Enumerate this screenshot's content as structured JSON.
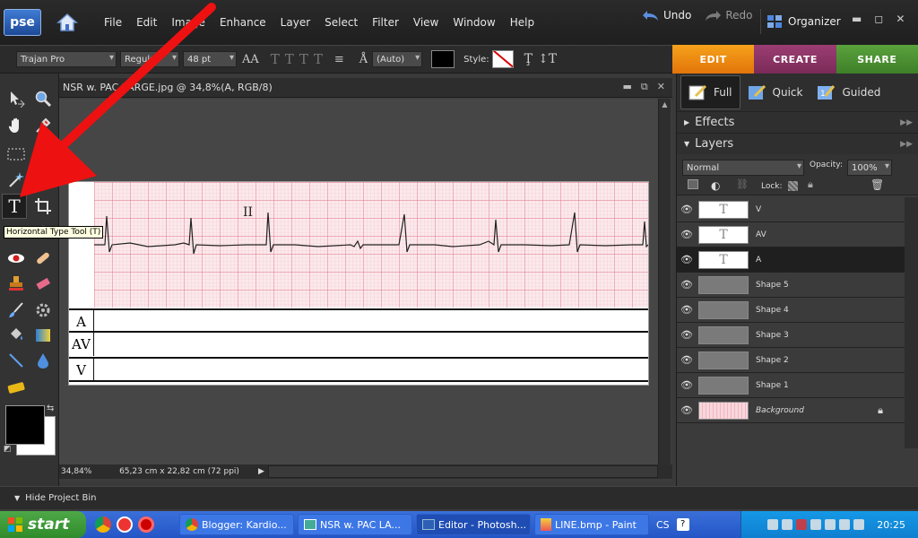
{
  "app": {
    "logo": "pse",
    "menus": [
      "File",
      "Edit",
      "Image",
      "Enhance",
      "Layer",
      "Select",
      "Filter",
      "View",
      "Window",
      "Help"
    ],
    "undo_label": "Undo",
    "redo_label": "Redo",
    "organizer_label": "Organizer"
  },
  "options": {
    "font_family": "Trajan Pro",
    "font_style": "Regular",
    "font_size": "48 pt",
    "leading": "(Auto)",
    "style_label": "Style:",
    "text_color": "#000000"
  },
  "mode_tabs": [
    "EDIT",
    "CREATE",
    "SHARE"
  ],
  "tooltip": "Horizontal Type Tool (T)",
  "document": {
    "title": "NSR w. PAC LARGE.jpg @ 34,8%(A, RGB/8)",
    "zoom": "34,84%",
    "dimensions": "65,23 cm x 22,82 cm (72 ppi)",
    "ecg_lead_label": "II",
    "rows": [
      "A",
      "AV",
      "V"
    ]
  },
  "view_tabs": [
    "Full",
    "Quick",
    "Guided"
  ],
  "panels": {
    "effects": "Effects",
    "layers": "Layers",
    "blend_mode": "Normal",
    "opacity_label": "Opacity:",
    "opacity_value": "100%",
    "lock_label": "Lock:"
  },
  "layers": [
    {
      "name": "V",
      "kind": "text",
      "selected": false
    },
    {
      "name": "AV",
      "kind": "text",
      "selected": false
    },
    {
      "name": "A",
      "kind": "text",
      "selected": true
    },
    {
      "name": "Shape 5",
      "kind": "shape",
      "selected": false
    },
    {
      "name": "Shape 4",
      "kind": "shape",
      "selected": false
    },
    {
      "name": "Shape 3",
      "kind": "shape",
      "selected": false
    },
    {
      "name": "Shape 2",
      "kind": "shape",
      "selected": false
    },
    {
      "name": "Shape 1",
      "kind": "shape",
      "selected": false
    },
    {
      "name": "Background",
      "kind": "background",
      "selected": false
    }
  ],
  "project_bin": "Hide Project Bin",
  "taskbar": {
    "start": "start",
    "tasks": [
      "Blogger: Kardio...",
      "NSR w. PAC LA...",
      "Editor - Photosh...",
      "LINE.bmp - Paint"
    ],
    "language": "CS",
    "clock": "20:25"
  },
  "colors": {
    "accent_edit": "#e2740a",
    "accent_create": "#7a2b58",
    "accent_share": "#3e7f28",
    "ecg_grid": "#e89aa7",
    "annotation": "#ee1111"
  }
}
